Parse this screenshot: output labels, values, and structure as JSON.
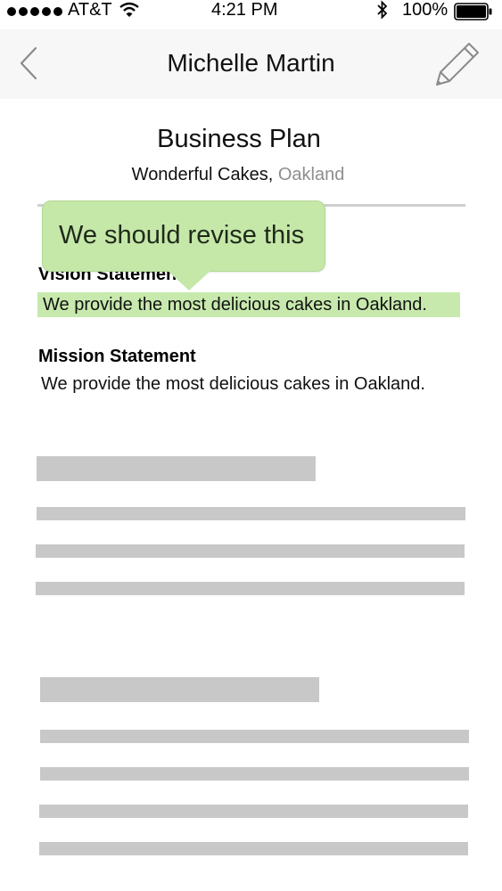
{
  "status_bar": {
    "carrier": "AT&T",
    "time": "4:21 PM",
    "battery": "100%"
  },
  "nav": {
    "title": "Michelle Martin",
    "back_icon": "chevron-left-icon",
    "edit_icon": "pencil-icon"
  },
  "document": {
    "title": "Business Plan",
    "company": "Wonderful Cakes,",
    "city": "Oakland"
  },
  "sections": {
    "vision": {
      "heading": "Vision Statement",
      "text": "We provide the most delicious cakes in Oakland."
    },
    "mission": {
      "heading": "Mission Statement",
      "text": "We provide the most delicious cakes in Oakland."
    }
  },
  "comment": {
    "text": "We should revise this"
  },
  "colors": {
    "highlight": "#c7e9ad",
    "comment_bubble": "#c5e8a9",
    "placeholder": "#c8c8c8",
    "nav_background": "#f7f7f7",
    "muted_text": "#8e8e8e"
  }
}
